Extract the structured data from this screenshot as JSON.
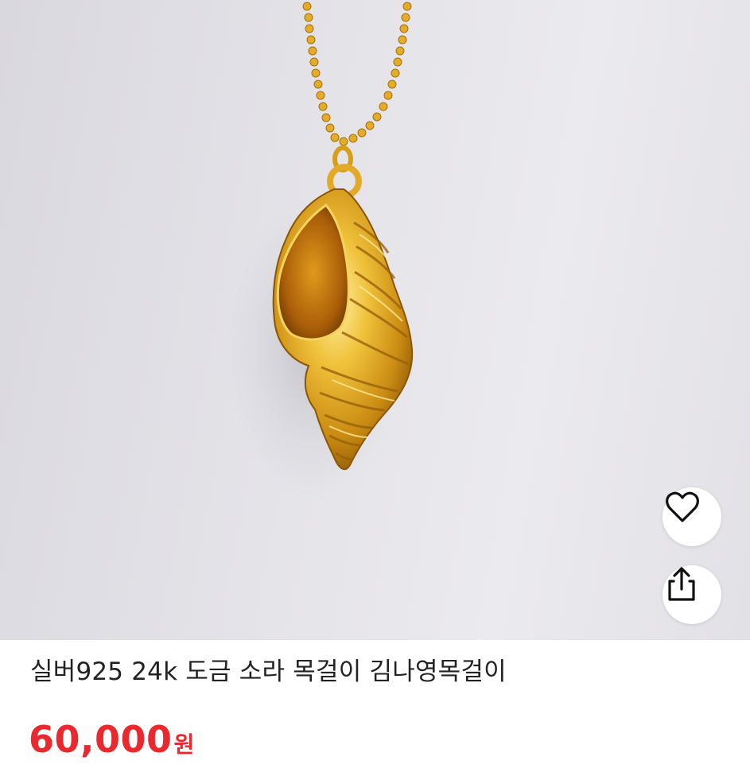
{
  "product": {
    "title": "실버925 24k 도금 소라 목걸이 김나영목걸이",
    "price_amount": "60,000",
    "price_unit": "원"
  },
  "actions": {
    "like_icon": "heart-outline-icon",
    "share_icon": "share-upload-icon"
  },
  "colors": {
    "price": "#e8292f",
    "title": "#222222",
    "gold": "#d9a21c"
  }
}
